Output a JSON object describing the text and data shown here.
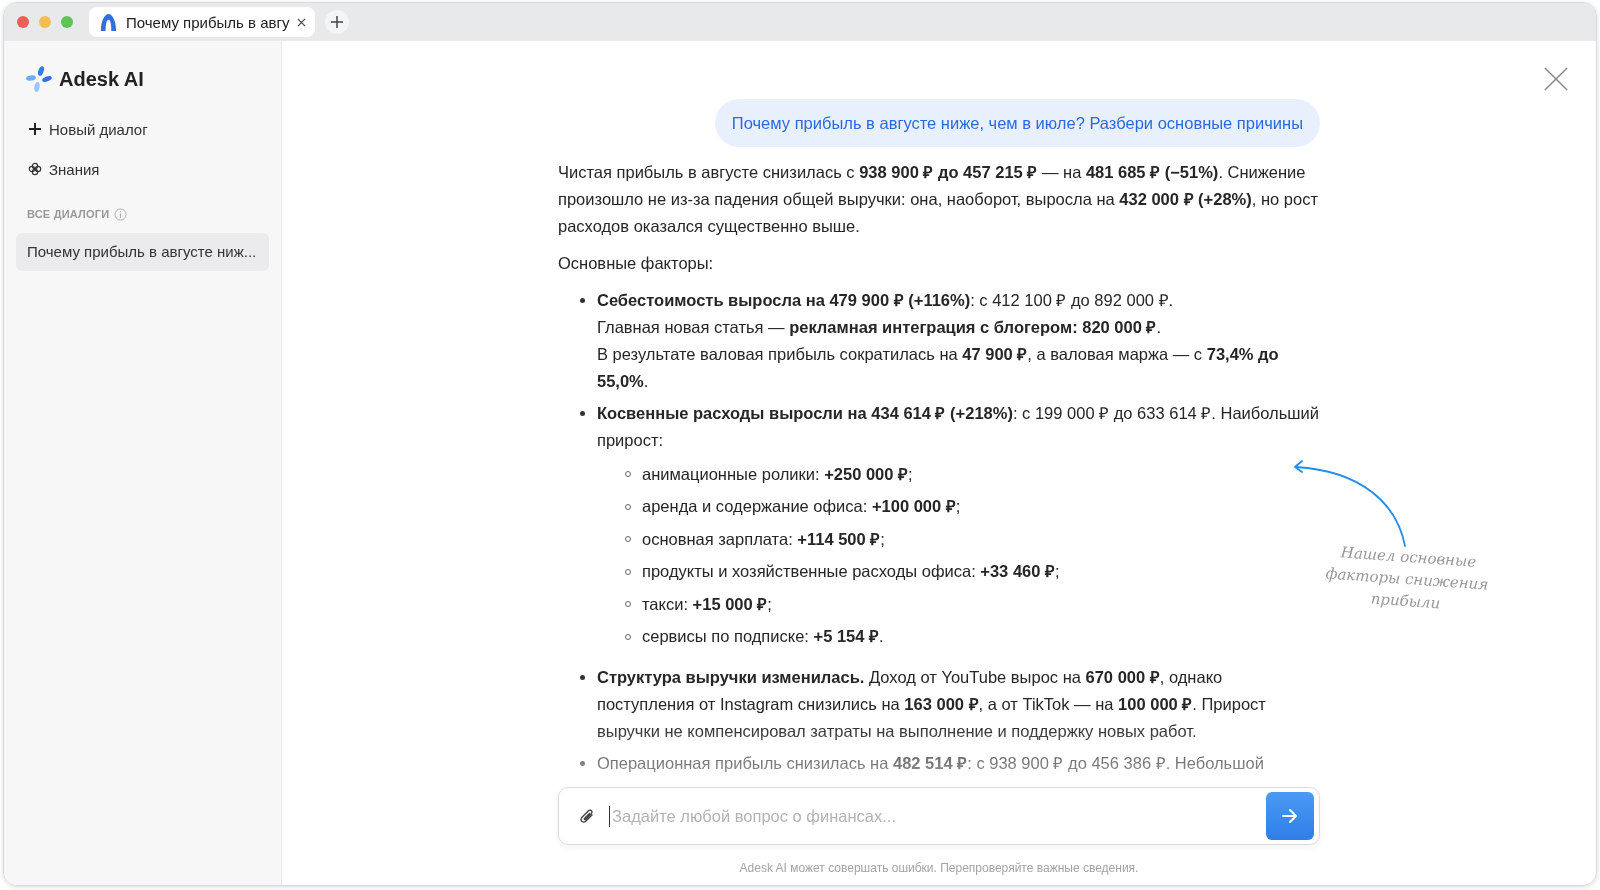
{
  "browser": {
    "tab_title": "Почему прибыль в авгу"
  },
  "sidebar": {
    "brand": "Adesk AI",
    "nav": [
      {
        "label": "Новый диалог",
        "kind": "new"
      },
      {
        "label": "Знания",
        "kind": "knowledge"
      }
    ],
    "section_title": "ВСЕ ДИАЛОГИ",
    "dialogs": [
      {
        "title": "Почему прибыль в августе ниж...",
        "selected": true
      }
    ]
  },
  "chat": {
    "user_message": "Почему прибыль в августе ниже, чем в июле? Разбери основные причины",
    "answer": [
      {
        "kind": "paragraph",
        "text": "Чистая прибыль в августе снизилась с **938 900 ₽ до 457 215 ₽** — на **481 685 ₽ (−51%)**. Снижение произошло не из-за падения общей выручки: она, наоборот, выросла на **432 000 ₽ (+28%)**, но рост расходов оказался существенно выше."
      },
      {
        "kind": "paragraph",
        "text": "Основные факторы:"
      },
      {
        "kind": "list",
        "items": [
          {
            "lines": [
              "**Себестоимость выросла на 479 900 ₽ (+116%)**: с 412 100 ₽ до 892 000 ₽.",
              "Главная новая статья — **рекламная интеграция с блогером: 820 000 ₽**.",
              "В результате валовая прибыль сократилась на **47 900 ₽**, а валовая маржа — с **73,4% до 55,0%**."
            ]
          },
          {
            "lines": [
              "**Косвенные расходы выросли на 434 614 ₽ (+218%)**: с 199 000 ₽ до 633 614 ₽. Наибольший прирост:"
            ],
            "children": [
              "анимационные ролики: **+250 000 ₽**;",
              "аренда и содержание офиса: **+100 000 ₽**;",
              "основная зарплата: **+114 500 ₽**;",
              "продукты и хозяйственные расходы офиса: **+33 460 ₽**;",
              "такси: **+15 000 ₽**;",
              "сервисы по подписке: **+5 154 ₽**."
            ]
          },
          {
            "lines": [
              "**Структура выручки изменилась.** Доход от YouTube вырос на **670 000 ₽**, однако поступления от Instagram снизились на **163 000 ₽**, а от TikTok — на **100 000 ₽**. Прирост выручки не компенсировал затраты на выполнение и поддержку новых работ."
            ]
          },
          {
            "lines": [
              "Операционная прибыль снизилась на **482 514 ₽**: с 938 900 ₽ до 456 386 ₽. Небольшой"
            ]
          }
        ]
      }
    ]
  },
  "annotation": "Нашел основные факторы снижения прибыли",
  "input": {
    "placeholder": "Задайте любой вопрос о финансах..."
  },
  "disclaimer": "Adesk AI может совершать ошибки. Перепроверяйте важные сведения."
}
